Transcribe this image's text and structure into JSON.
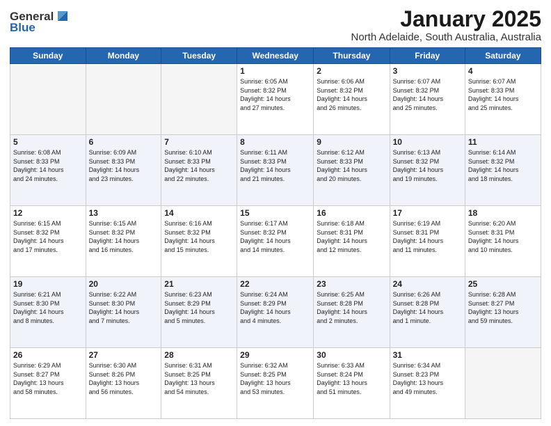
{
  "header": {
    "logo_general": "General",
    "logo_blue": "Blue",
    "month_title": "January 2025",
    "location": "North Adelaide, South Australia, Australia"
  },
  "weekdays": [
    "Sunday",
    "Monday",
    "Tuesday",
    "Wednesday",
    "Thursday",
    "Friday",
    "Saturday"
  ],
  "weeks": [
    [
      {
        "day": "",
        "info": ""
      },
      {
        "day": "",
        "info": ""
      },
      {
        "day": "",
        "info": ""
      },
      {
        "day": "1",
        "info": "Sunrise: 6:05 AM\nSunset: 8:32 PM\nDaylight: 14 hours\nand 27 minutes."
      },
      {
        "day": "2",
        "info": "Sunrise: 6:06 AM\nSunset: 8:32 PM\nDaylight: 14 hours\nand 26 minutes."
      },
      {
        "day": "3",
        "info": "Sunrise: 6:07 AM\nSunset: 8:32 PM\nDaylight: 14 hours\nand 25 minutes."
      },
      {
        "day": "4",
        "info": "Sunrise: 6:07 AM\nSunset: 8:33 PM\nDaylight: 14 hours\nand 25 minutes."
      }
    ],
    [
      {
        "day": "5",
        "info": "Sunrise: 6:08 AM\nSunset: 8:33 PM\nDaylight: 14 hours\nand 24 minutes."
      },
      {
        "day": "6",
        "info": "Sunrise: 6:09 AM\nSunset: 8:33 PM\nDaylight: 14 hours\nand 23 minutes."
      },
      {
        "day": "7",
        "info": "Sunrise: 6:10 AM\nSunset: 8:33 PM\nDaylight: 14 hours\nand 22 minutes."
      },
      {
        "day": "8",
        "info": "Sunrise: 6:11 AM\nSunset: 8:33 PM\nDaylight: 14 hours\nand 21 minutes."
      },
      {
        "day": "9",
        "info": "Sunrise: 6:12 AM\nSunset: 8:33 PM\nDaylight: 14 hours\nand 20 minutes."
      },
      {
        "day": "10",
        "info": "Sunrise: 6:13 AM\nSunset: 8:32 PM\nDaylight: 14 hours\nand 19 minutes."
      },
      {
        "day": "11",
        "info": "Sunrise: 6:14 AM\nSunset: 8:32 PM\nDaylight: 14 hours\nand 18 minutes."
      }
    ],
    [
      {
        "day": "12",
        "info": "Sunrise: 6:15 AM\nSunset: 8:32 PM\nDaylight: 14 hours\nand 17 minutes."
      },
      {
        "day": "13",
        "info": "Sunrise: 6:15 AM\nSunset: 8:32 PM\nDaylight: 14 hours\nand 16 minutes."
      },
      {
        "day": "14",
        "info": "Sunrise: 6:16 AM\nSunset: 8:32 PM\nDaylight: 14 hours\nand 15 minutes."
      },
      {
        "day": "15",
        "info": "Sunrise: 6:17 AM\nSunset: 8:32 PM\nDaylight: 14 hours\nand 14 minutes."
      },
      {
        "day": "16",
        "info": "Sunrise: 6:18 AM\nSunset: 8:31 PM\nDaylight: 14 hours\nand 12 minutes."
      },
      {
        "day": "17",
        "info": "Sunrise: 6:19 AM\nSunset: 8:31 PM\nDaylight: 14 hours\nand 11 minutes."
      },
      {
        "day": "18",
        "info": "Sunrise: 6:20 AM\nSunset: 8:31 PM\nDaylight: 14 hours\nand 10 minutes."
      }
    ],
    [
      {
        "day": "19",
        "info": "Sunrise: 6:21 AM\nSunset: 8:30 PM\nDaylight: 14 hours\nand 8 minutes."
      },
      {
        "day": "20",
        "info": "Sunrise: 6:22 AM\nSunset: 8:30 PM\nDaylight: 14 hours\nand 7 minutes."
      },
      {
        "day": "21",
        "info": "Sunrise: 6:23 AM\nSunset: 8:29 PM\nDaylight: 14 hours\nand 5 minutes."
      },
      {
        "day": "22",
        "info": "Sunrise: 6:24 AM\nSunset: 8:29 PM\nDaylight: 14 hours\nand 4 minutes."
      },
      {
        "day": "23",
        "info": "Sunrise: 6:25 AM\nSunset: 8:28 PM\nDaylight: 14 hours\nand 2 minutes."
      },
      {
        "day": "24",
        "info": "Sunrise: 6:26 AM\nSunset: 8:28 PM\nDaylight: 14 hours\nand 1 minute."
      },
      {
        "day": "25",
        "info": "Sunrise: 6:28 AM\nSunset: 8:27 PM\nDaylight: 13 hours\nand 59 minutes."
      }
    ],
    [
      {
        "day": "26",
        "info": "Sunrise: 6:29 AM\nSunset: 8:27 PM\nDaylight: 13 hours\nand 58 minutes."
      },
      {
        "day": "27",
        "info": "Sunrise: 6:30 AM\nSunset: 8:26 PM\nDaylight: 13 hours\nand 56 minutes."
      },
      {
        "day": "28",
        "info": "Sunrise: 6:31 AM\nSunset: 8:25 PM\nDaylight: 13 hours\nand 54 minutes."
      },
      {
        "day": "29",
        "info": "Sunrise: 6:32 AM\nSunset: 8:25 PM\nDaylight: 13 hours\nand 53 minutes."
      },
      {
        "day": "30",
        "info": "Sunrise: 6:33 AM\nSunset: 8:24 PM\nDaylight: 13 hours\nand 51 minutes."
      },
      {
        "day": "31",
        "info": "Sunrise: 6:34 AM\nSunset: 8:23 PM\nDaylight: 13 hours\nand 49 minutes."
      },
      {
        "day": "",
        "info": ""
      }
    ]
  ]
}
